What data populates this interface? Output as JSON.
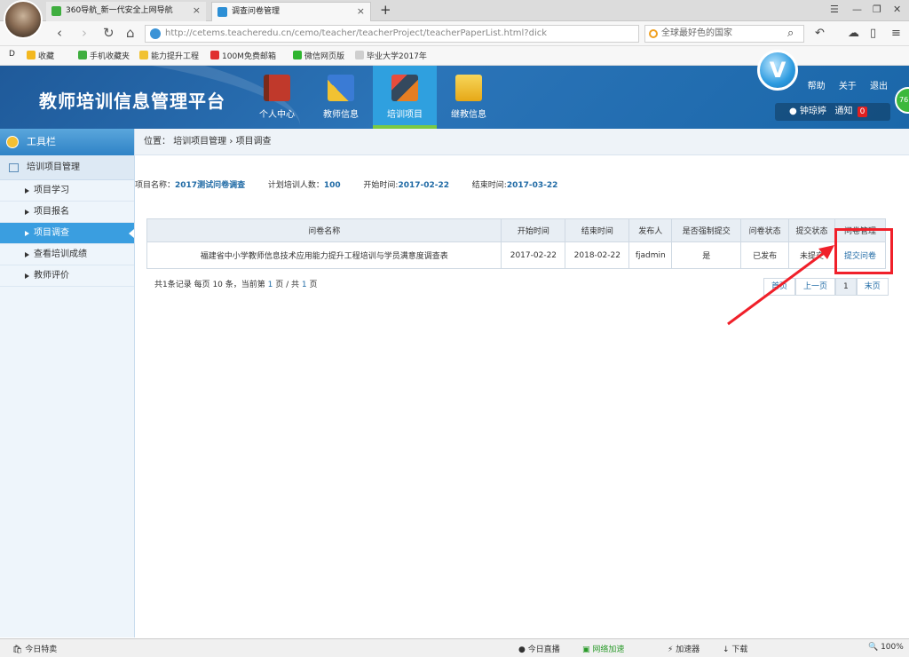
{
  "browser": {
    "tabs": [
      {
        "title": "360导航_新一代安全上网导航",
        "icon_color": "#3fae3f"
      },
      {
        "title": "调查问卷管理",
        "icon_color": "#2d8fd5"
      }
    ],
    "new_tab": "+",
    "url": "http://cetems.teacheredu.cn/cemo/teacher/teacherProject/teacherPaperList.html?dick",
    "search_placeholder": "全球最好色的国家",
    "bookmarks": [
      "收藏",
      "手机收藏夹",
      "能力提升工程",
      "100M免费邮箱",
      "微信网页版",
      "毕业大学2017年"
    ],
    "bookmark_icons": [
      "star-icon",
      "phone-icon",
      "folder-icon",
      "mail-icon",
      "wechat-icon",
      "page-icon"
    ]
  },
  "header": {
    "site_title": "教师培训信息管理平台",
    "nav": [
      {
        "label": "个人中心",
        "icon": "book-icon",
        "color": "#c0392b"
      },
      {
        "label": "教师信息",
        "icon": "pencil-ruler-icon",
        "color": "#3a7bd5"
      },
      {
        "label": "培训项目",
        "icon": "tools-icon",
        "color": "#e67e22"
      },
      {
        "label": "继教信息",
        "icon": "box-icon",
        "color": "#f1c40f"
      }
    ],
    "links": [
      "帮助",
      "关于",
      "退出"
    ],
    "username": "钟琼婷",
    "notify_label": "通知",
    "notify_count": "0",
    "v_badge": "V",
    "side_badge": "76"
  },
  "sidebar": {
    "title": "工具栏",
    "group": "培训项目管理",
    "items": [
      "项目学习",
      "项目报名",
      "项目调查",
      "查看培训成绩",
      "教师评价"
    ]
  },
  "main": {
    "breadcrumb_label": "位置：",
    "breadcrumb": [
      "培训项目管理",
      "项目调查"
    ],
    "info": {
      "project_label": "项目名称：",
      "project_value": "2017测试问卷调查",
      "plan_label": "计划培训人数：",
      "plan_value": "100",
      "start_label": "开始时间:",
      "start_value": "2017-02-22",
      "end_label": "结束时间:",
      "end_value": "2017-03-22"
    },
    "table": {
      "headers": [
        "问卷名称",
        "开始时间",
        "结束时间",
        "发布人",
        "是否强制提交",
        "问卷状态",
        "提交状态",
        "问卷管理"
      ],
      "rows": [
        [
          "福建省中小学教师信息技术应用能力提升工程培训与学员满意度调查表",
          "2017-02-22",
          "2018-02-22",
          "fjadmin",
          "是",
          "已发布",
          "未提交",
          "提交问卷"
        ]
      ]
    },
    "page_info": {
      "prefix": "共1条记录 每页 10 条，当前第",
      "current": "1",
      "middle": "页 / 共",
      "total": "1",
      "suffix": "页"
    },
    "pager": [
      "首页",
      "上一页",
      "1",
      "末页"
    ]
  },
  "statusbar": {
    "left": "今日特卖",
    "items": [
      "今日直播",
      "网络加速",
      "加速器",
      "下载",
      "100%"
    ]
  },
  "colors": {
    "header_bg": "#2b74b8",
    "accent": "#3a9ee0",
    "highlight": "#f0202a"
  }
}
